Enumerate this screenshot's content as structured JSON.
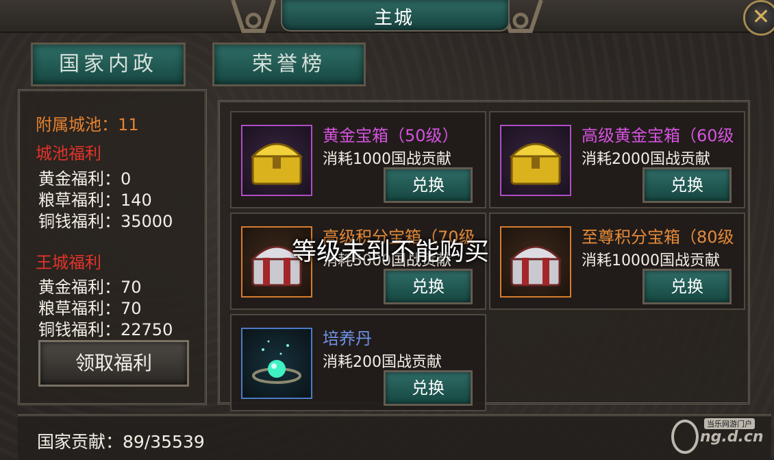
{
  "header": {
    "title": "主城",
    "close_icon": "close-x-icon"
  },
  "tabs": [
    {
      "label": "国家内政"
    },
    {
      "label": "荣誉榜"
    }
  ],
  "left_panel": {
    "attached_cities": "附属城池：11",
    "city_welfare_title": "城池福利",
    "city_welfare": [
      "黄金福利：0",
      "粮草福利：140",
      "铜钱福利：35000"
    ],
    "royal_welfare_title": "王城福利",
    "royal_welfare": [
      "黄金福利：70",
      "粮草福利：70",
      "铜钱福利：22750"
    ],
    "claim_label": "领取福利"
  },
  "shop": {
    "exchange_label": "兑换",
    "items": [
      {
        "name": "黄金宝箱（50级）",
        "cost": "消耗1000国战贡献",
        "icon": "gold-chest-icon"
      },
      {
        "name": "高级黄金宝箱（60级",
        "cost": "消耗2000国战贡献",
        "icon": "gold-chest-icon"
      },
      {
        "name": "高级积分宝箱（70级",
        "cost": "消耗5000国战贡献",
        "icon": "silver-red-chest-icon"
      },
      {
        "name": "至尊积分宝箱（80级",
        "cost": "消耗10000国战贡献",
        "icon": "silver-red-chest-icon"
      },
      {
        "name": "培养丹",
        "cost": "消耗200国战贡献",
        "icon": "glowing-pill-icon"
      }
    ]
  },
  "overlay_message": "等级未到不能购买",
  "footer": {
    "contribution": "国家贡献：89/35539"
  },
  "watermark": {
    "top": "当乐网游门户",
    "main": "ng.d.cn"
  },
  "colors": {
    "accent_teal": "#2f6c66",
    "orange": "#e58230",
    "red": "#e2332a",
    "purple": "#d653e0",
    "blue": "#6f93e8"
  }
}
